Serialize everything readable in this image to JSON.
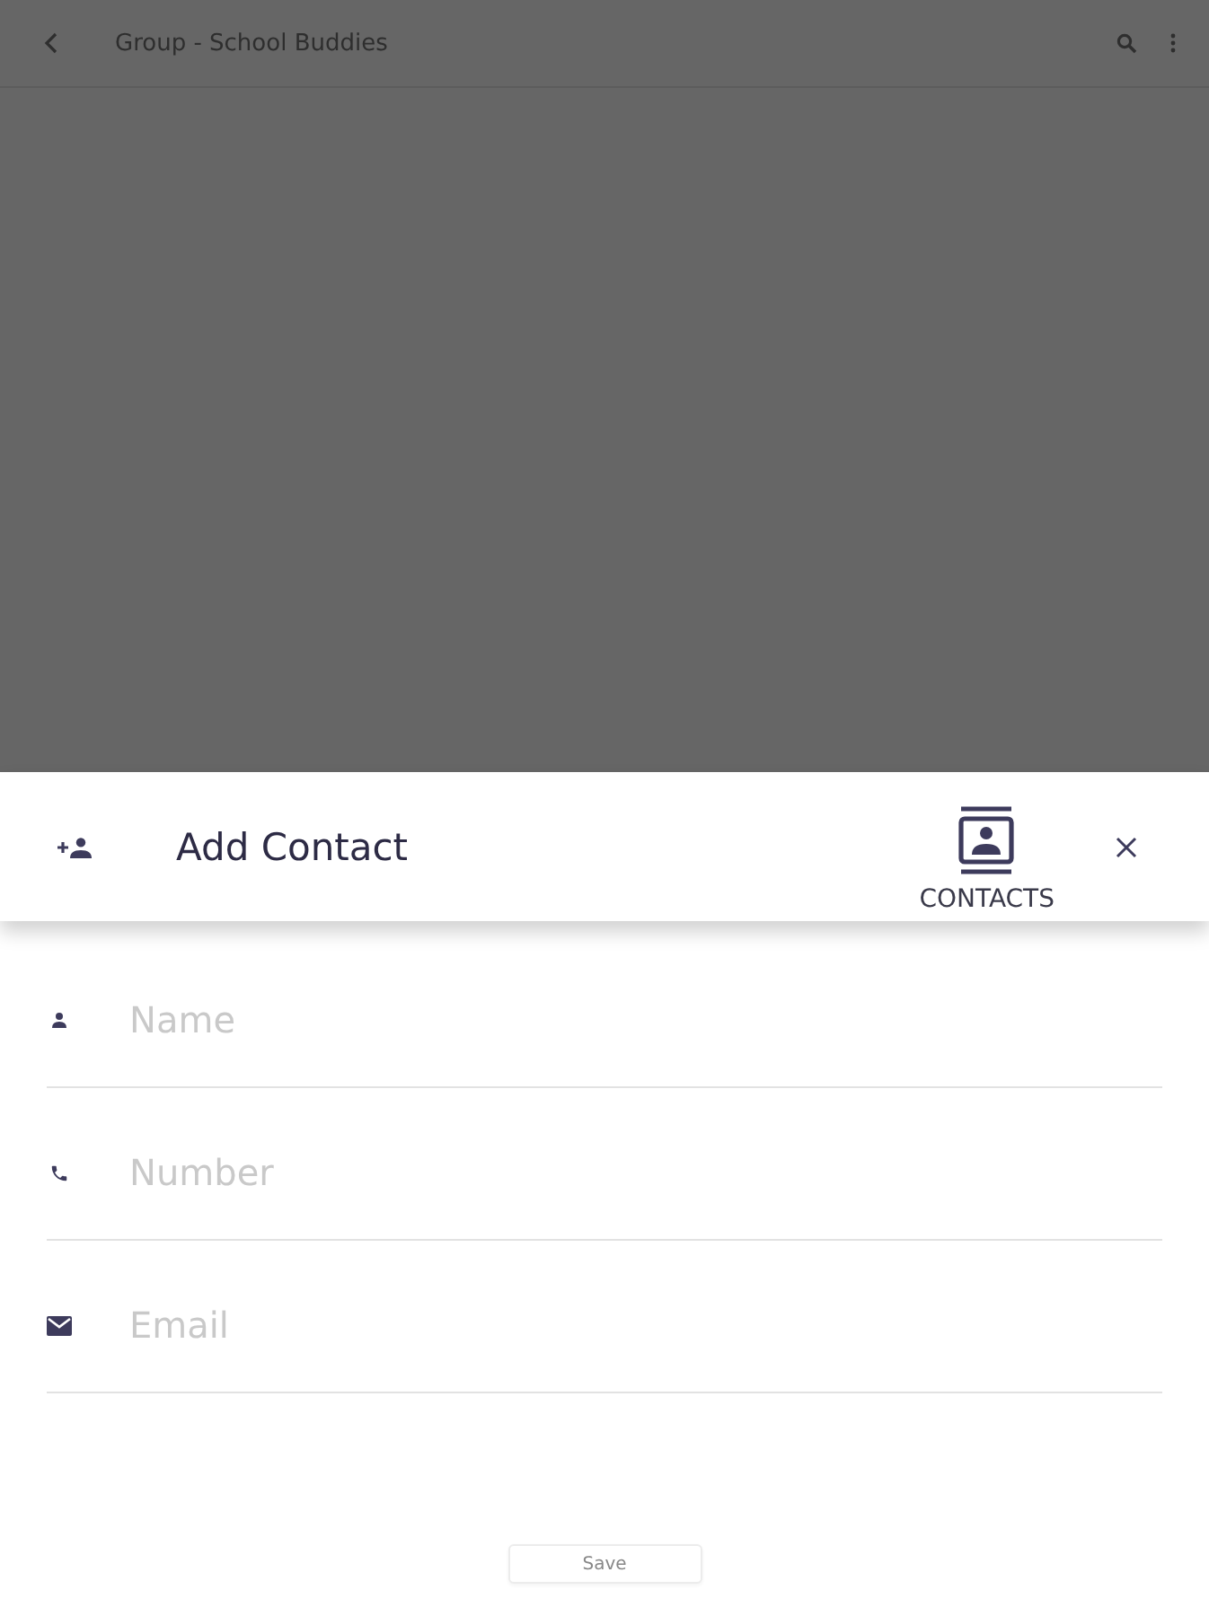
{
  "app_bar": {
    "title": "Group - School Buddies"
  },
  "sheet": {
    "title": "Add Contact",
    "contacts_label": "CONTACTS"
  },
  "fields": [
    {
      "kind": "person",
      "placeholder": "Name"
    },
    {
      "kind": "phone",
      "placeholder": "Number"
    },
    {
      "kind": "email",
      "placeholder": "Email"
    }
  ],
  "save_button": "Save"
}
